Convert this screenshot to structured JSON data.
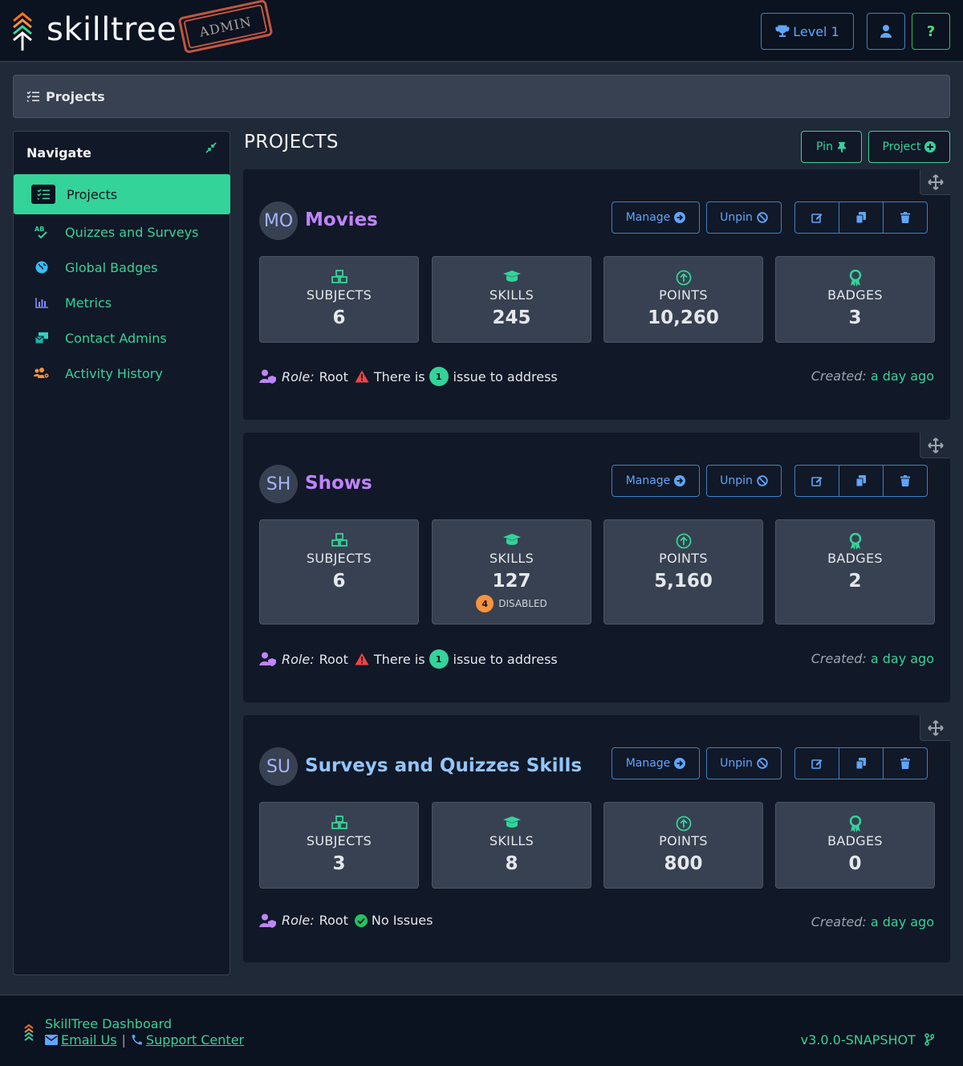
{
  "header": {
    "logo_text": "skilltree",
    "stamp_text": "ADMIN",
    "level_label": "Level 1"
  },
  "breadcrumb": {
    "label": "Projects"
  },
  "sidebar": {
    "title": "Navigate",
    "items": [
      {
        "label": "Projects",
        "icon": "list-check-icon",
        "active": true
      },
      {
        "label": "Quizzes and Surveys",
        "icon": "spellcheck-icon"
      },
      {
        "label": "Global Badges",
        "icon": "globe-icon"
      },
      {
        "label": "Metrics",
        "icon": "bar-chart-icon"
      },
      {
        "label": "Contact Admins",
        "icon": "mail-bulk-icon"
      },
      {
        "label": "Activity History",
        "icon": "users-cog-icon"
      }
    ]
  },
  "main": {
    "title": "PROJECTS",
    "pin_label": "Pin",
    "project_label": "Project"
  },
  "labels": {
    "manage": "Manage",
    "unpin": "Unpin",
    "subjects": "SUBJECTS",
    "skills": "SKILLS",
    "points": "POINTS",
    "badges": "BADGES",
    "role_prefix": "Role:",
    "role": "Root",
    "issue_pre": "There is",
    "issue_post": "issue to address",
    "no_issues": "No Issues",
    "created_prefix": "Created:",
    "disabled": "DISABLED"
  },
  "projects": [
    {
      "initials": "MO",
      "name": "Movies",
      "subjects": "6",
      "skills": "245",
      "points": "10,260",
      "badges": "3",
      "issues": "1",
      "created": "a day ago"
    },
    {
      "initials": "SH",
      "name": "Shows",
      "subjects": "6",
      "skills": "127",
      "disabled": "4",
      "points": "5,160",
      "badges": "2",
      "issues": "1",
      "created": "a day ago"
    },
    {
      "initials": "SU",
      "name": "Surveys and Quizzes Skills",
      "subjects": "3",
      "skills": "8",
      "points": "800",
      "badges": "0",
      "created": "a day ago"
    }
  ],
  "footer": {
    "title": "SkillTree Dashboard",
    "email": "Email Us",
    "support": "Support Center",
    "version": "v3.0.0-SNAPSHOT"
  },
  "colors": {
    "accent": "#34d399",
    "primary": "#60a5fa",
    "project_name": "#c084fc",
    "warning": "#ef4444"
  }
}
